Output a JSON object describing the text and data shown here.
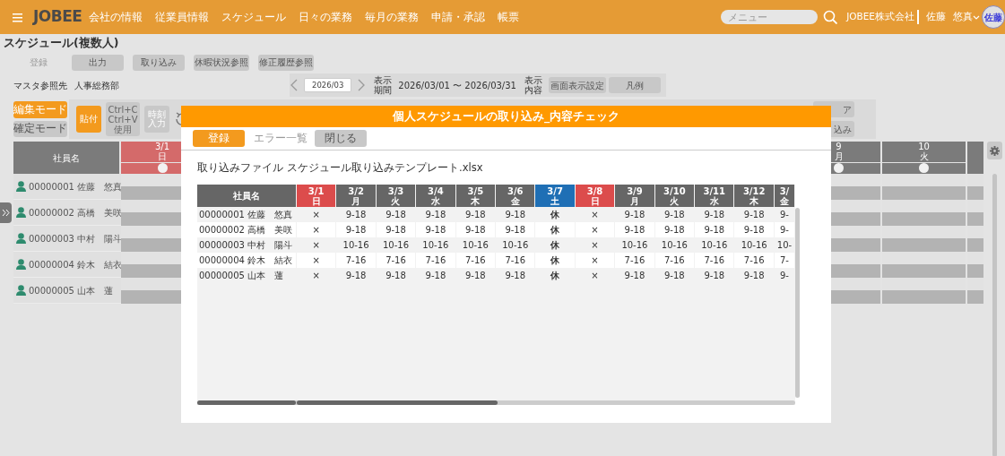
{
  "navbar": {
    "logo": "JOBEE",
    "menu": [
      "会社の情報",
      "従業員情報",
      "スケジュール",
      "日々の業務",
      "毎月の業務",
      "申請・承認",
      "帳票"
    ],
    "search": {
      "placeholder": "メニュー"
    },
    "company": "JOBEE株式会社",
    "user_last": "佐藤",
    "user_first": "悠真",
    "avatar": "佐藤"
  },
  "page_title": "スケジュール(複数人)",
  "actions": [
    {
      "label": "登録",
      "disabled": true
    },
    {
      "label": "出力",
      "disabled": false
    },
    {
      "label": "取り込み",
      "disabled": false
    },
    {
      "label": "休暇状況参照",
      "disabled": false
    },
    {
      "label": "修正履歴参照",
      "disabled": false
    }
  ],
  "master": {
    "label": "マスタ参照先",
    "value": "人事総務部"
  },
  "period_nav": {
    "month": "2026/03",
    "period_label": "表示期間",
    "range": "2026/03/01 〜 2026/03/31",
    "content_label": "表示内容",
    "buttons": [
      "画面表示設定",
      "凡例"
    ]
  },
  "modes": [
    {
      "label": "編集モード",
      "selected": true
    },
    {
      "label": "確定モード",
      "selected": false
    }
  ],
  "tools": [
    {
      "lines": [
        "貼付"
      ],
      "kind": "primary"
    },
    {
      "lines": [
        "Ctrl+C",
        "Ctrl+V",
        "使用"
      ],
      "kind": "small"
    },
    {
      "lines": [
        "時刻",
        "入力"
      ],
      "kind": "secondary"
    }
  ],
  "partial_buttons": [
    "ア",
    "込み"
  ],
  "schedule_grid": {
    "name_header": "社員名",
    "columns": [
      {
        "date": "3/1",
        "weekday": "日",
        "kind": "sunday"
      },
      {
        "date": "9",
        "weekday": "月",
        "kind": "weekday"
      },
      {
        "date": "10",
        "weekday": "火",
        "kind": "weekday"
      }
    ],
    "employees": [
      "00000001 佐藤　悠真",
      "00000002 高橋　美咲",
      "00000003 中村　陽斗",
      "00000004 鈴木　結衣",
      "00000005 山本　蓮"
    ]
  },
  "modal": {
    "title": "個人スケジュールの取り込み_内容チェック",
    "buttons": [
      {
        "label": "登録",
        "kind": "primary"
      },
      {
        "label": "エラー一覧",
        "kind": "disabled"
      },
      {
        "label": "閉じる",
        "kind": "secondary"
      }
    ],
    "file_label": "取り込みファイル",
    "file_name": "スケジュール取り込みテンプレート.xlsx",
    "table": {
      "name_header": "社員名",
      "columns": [
        {
          "date": "3/1",
          "weekday": "日",
          "kind": "sunday"
        },
        {
          "date": "3/2",
          "weekday": "月",
          "kind": "weekday"
        },
        {
          "date": "3/3",
          "weekday": "火",
          "kind": "weekday"
        },
        {
          "date": "3/4",
          "weekday": "水",
          "kind": "weekday"
        },
        {
          "date": "3/5",
          "weekday": "木",
          "kind": "weekday"
        },
        {
          "date": "3/6",
          "weekday": "金",
          "kind": "weekday"
        },
        {
          "date": "3/7",
          "weekday": "土",
          "kind": "saturday"
        },
        {
          "date": "3/8",
          "weekday": "日",
          "kind": "sunday"
        },
        {
          "date": "3/9",
          "weekday": "月",
          "kind": "weekday"
        },
        {
          "date": "3/10",
          "weekday": "火",
          "kind": "weekday"
        },
        {
          "date": "3/11",
          "weekday": "水",
          "kind": "weekday"
        },
        {
          "date": "3/12",
          "weekday": "木",
          "kind": "weekday"
        },
        {
          "date": "3/",
          "weekday": "金",
          "kind": "weekday"
        }
      ],
      "rows": [
        {
          "employee": "00000001 佐藤　悠真",
          "cells": [
            "×",
            "9-18",
            "9-18",
            "9-18",
            "9-18",
            "9-18",
            "休",
            "×",
            "9-18",
            "9-18",
            "9-18",
            "9-18",
            "9-"
          ]
        },
        {
          "employee": "00000002 高橋　美咲",
          "cells": [
            "×",
            "9-18",
            "9-18",
            "9-18",
            "9-18",
            "9-18",
            "休",
            "×",
            "9-18",
            "9-18",
            "9-18",
            "9-18",
            "9-"
          ]
        },
        {
          "employee": "00000003 中村　陽斗",
          "cells": [
            "×",
            "10-16",
            "10-16",
            "10-16",
            "10-16",
            "10-16",
            "休",
            "×",
            "10-16",
            "10-16",
            "10-16",
            "10-16",
            "10-"
          ]
        },
        {
          "employee": "00000004 鈴木　結衣",
          "cells": [
            "×",
            "7-16",
            "7-16",
            "7-16",
            "7-16",
            "7-16",
            "休",
            "×",
            "7-16",
            "7-16",
            "7-16",
            "7-16",
            "7-"
          ]
        },
        {
          "employee": "00000005 山本　蓮",
          "cells": [
            "×",
            "9-18",
            "9-18",
            "9-18",
            "9-18",
            "9-18",
            "休",
            "×",
            "9-18",
            "9-18",
            "9-18",
            "9-18",
            "9-"
          ]
        }
      ]
    }
  }
}
